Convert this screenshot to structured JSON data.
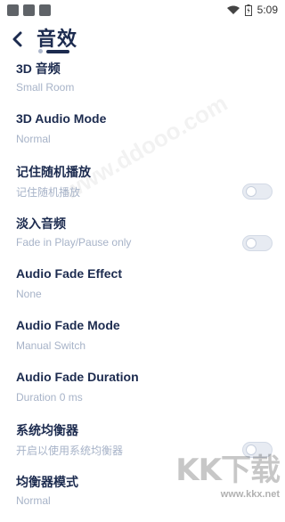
{
  "status_bar": {
    "time": "5:09"
  },
  "header": {
    "title": "音效"
  },
  "settings": [
    {
      "title": "3D 音频",
      "subtitle": "Small Room",
      "toggle": false
    },
    {
      "title": "3D Audio Mode",
      "subtitle": "Normal",
      "toggle": false
    },
    {
      "title": "记住随机播放",
      "subtitle": "记住随机播放",
      "toggle": true,
      "toggle_on": false
    },
    {
      "title": "淡入音频",
      "subtitle": "Fade in Play/Pause only",
      "toggle": true,
      "toggle_on": false
    },
    {
      "title": "Audio Fade Effect",
      "subtitle": "None",
      "toggle": false
    },
    {
      "title": "Audio Fade Mode",
      "subtitle": "Manual Switch",
      "toggle": false
    },
    {
      "title": "Audio Fade Duration",
      "subtitle": "Duration 0 ms",
      "toggle": false
    },
    {
      "title": "系统均衡器",
      "subtitle": "开启以使用系统均衡器",
      "toggle": true,
      "toggle_on": false
    },
    {
      "title": "均衡器模式",
      "subtitle": "Normal",
      "toggle": false
    }
  ],
  "watermark": {
    "logo": "KK下载",
    "url": "www.kkx.net"
  }
}
